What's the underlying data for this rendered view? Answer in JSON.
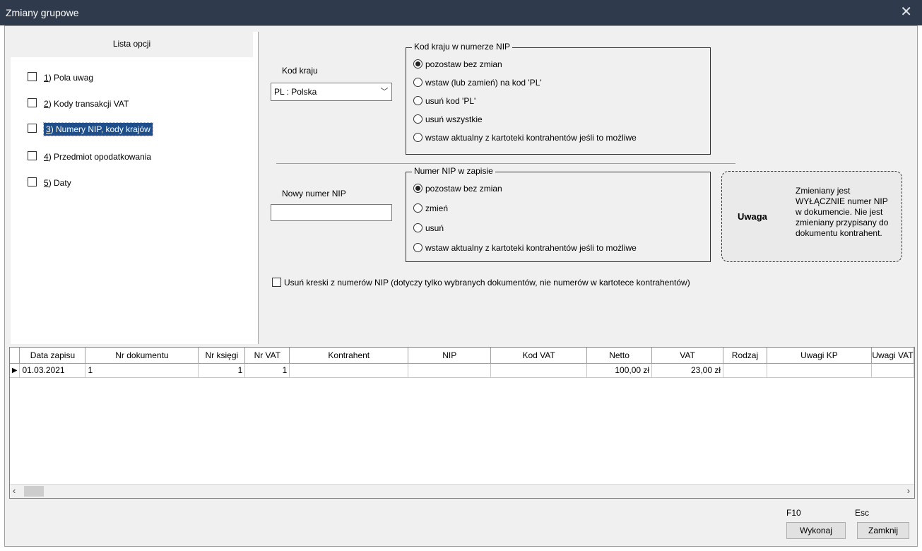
{
  "window": {
    "title": "Zmiany grupowe"
  },
  "options": {
    "header": "Lista opcji",
    "items": [
      {
        "key": "1",
        "label": ") Pola uwag"
      },
      {
        "key": "2",
        "label": ") Kody transakcji VAT"
      },
      {
        "key": "3",
        "label": ") Numery NIP, kody krajów"
      },
      {
        "key": "4",
        "label": ") Przedmiot opodatkowania"
      },
      {
        "key": "5",
        "label": ") Daty"
      }
    ],
    "selected_index": 2
  },
  "country": {
    "label": "Kod kraju",
    "value": "PL : Polska",
    "group_title": "Kod kraju w numerze NIP",
    "radios": [
      "pozostaw bez zmian",
      "wstaw (lub zamień) na kod 'PL'",
      "usuń kod 'PL'",
      "usuń wszystkie",
      "wstaw aktualny z kartoteki kontrahentów jeśli to możliwe"
    ],
    "selected": 0
  },
  "nip": {
    "label": "Nowy numer NIP",
    "value": "",
    "group_title": "Numer NIP w zapisie",
    "radios": [
      "pozostaw bez zmian",
      "zmień",
      "usuń",
      "wstaw aktualny z kartoteki kontrahentów jeśli to możliwe"
    ],
    "selected": 0
  },
  "note": {
    "title": "Uwaga",
    "lines": [
      "Zmieniany jest",
      "WYŁĄCZNIE numer NIP",
      "w dokumencie. Nie jest",
      "zmieniany przypisany do",
      "dokumentu kontrahent."
    ]
  },
  "remove_dashes": {
    "label": "Usuń kreski z numerów NIP (dotyczy tylko wybranych dokumentów, nie numerów w kartotece kontrahentów)",
    "checked": false
  },
  "grid": {
    "columns": [
      "Data zapisu",
      "Nr dokumentu",
      "Nr księgi",
      "Nr VAT",
      "Kontrahent",
      "NIP",
      "Kod VAT",
      "Netto",
      "VAT",
      "Rodzaj",
      "Uwagi KP",
      "Uwagi VAT"
    ],
    "rows": [
      [
        "01.03.2021",
        "1",
        "1",
        "1",
        "",
        "",
        "",
        "100,00 zł",
        "23,00 zł",
        "",
        "",
        ""
      ]
    ]
  },
  "buttons": {
    "execute": {
      "key": "F10",
      "label": "Wykonaj"
    },
    "close": {
      "key": "Esc",
      "label": "Zamknij"
    }
  }
}
